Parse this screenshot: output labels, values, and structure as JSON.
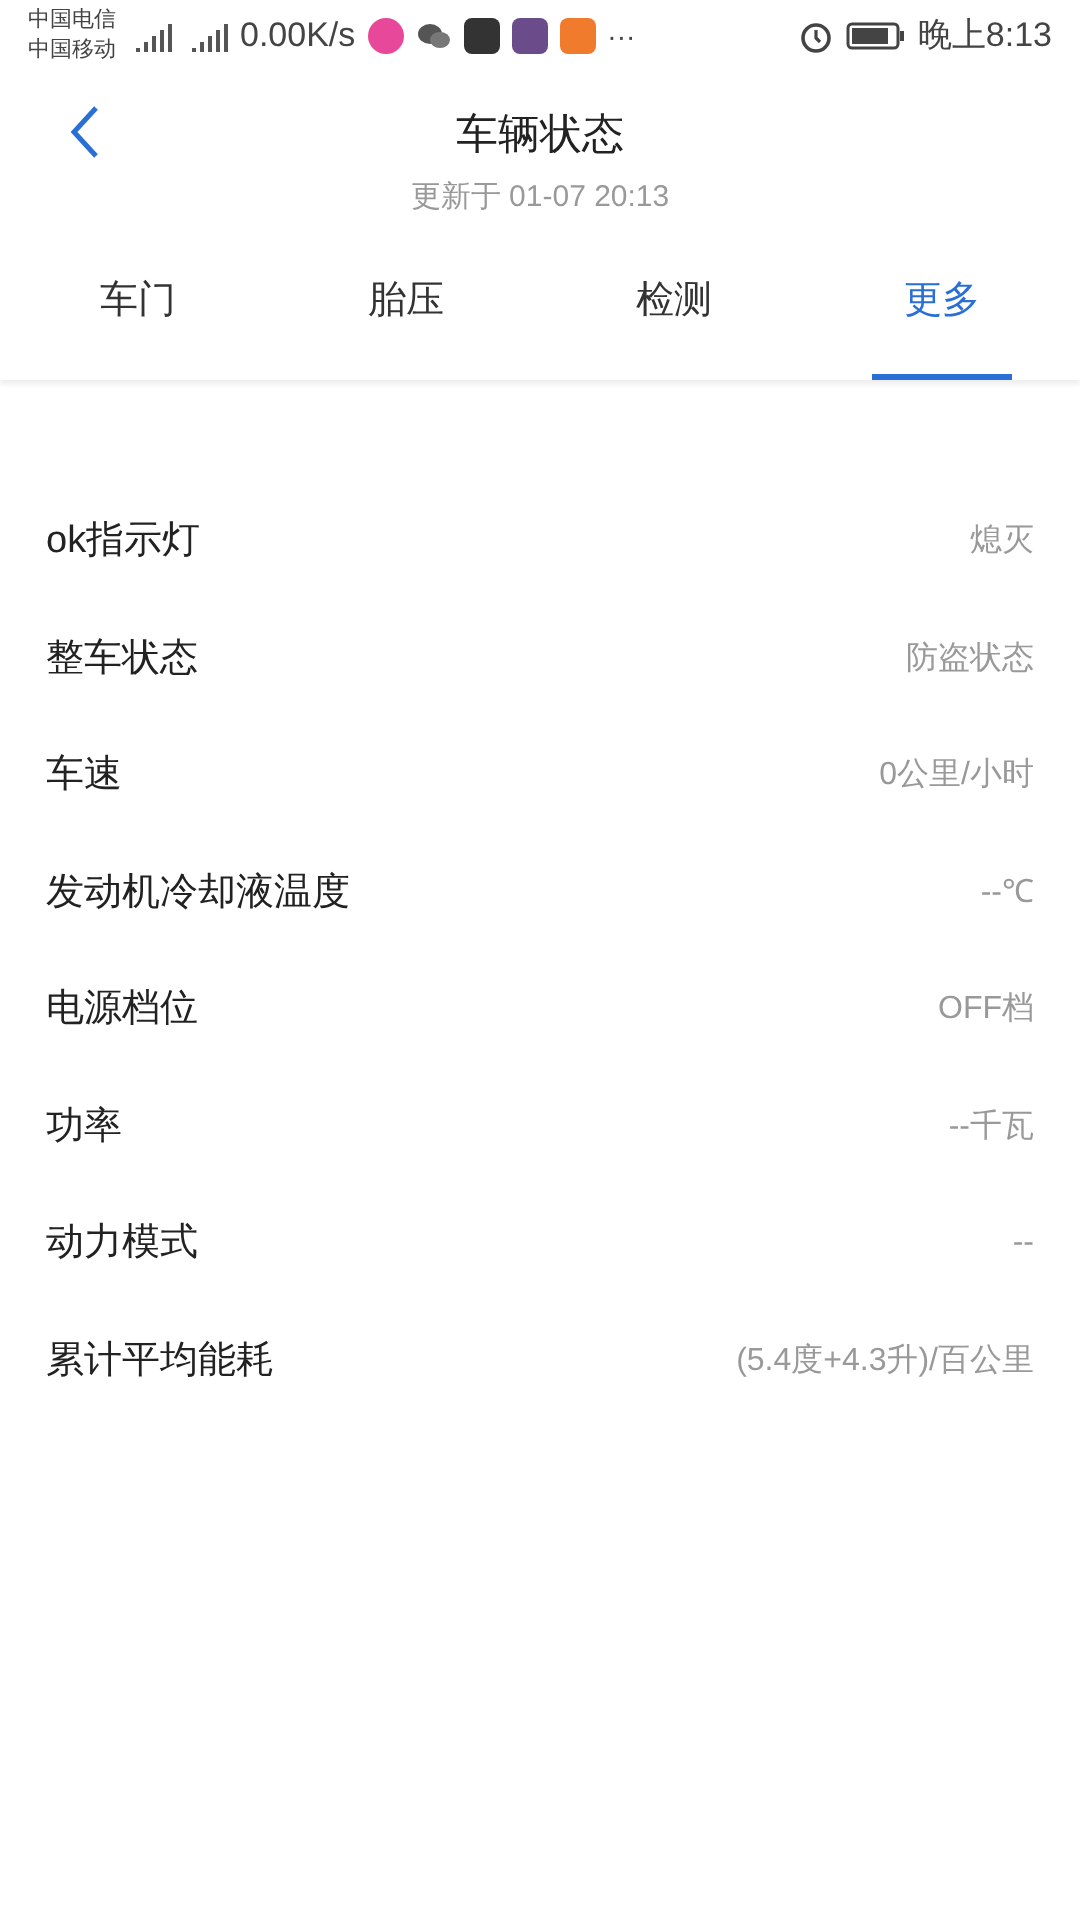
{
  "status_bar": {
    "carriers": [
      "中国电信",
      "中国移动"
    ],
    "speed": "0.00K/s",
    "more": "···",
    "time": "晚上8:13"
  },
  "header": {
    "title": "车辆状态",
    "subtitle": "更新于 01-07 20:13"
  },
  "tabs": [
    {
      "label": "车门",
      "selected": false
    },
    {
      "label": "胎压",
      "selected": false
    },
    {
      "label": "检测",
      "selected": false
    },
    {
      "label": "更多",
      "selected": true
    }
  ],
  "rows": [
    {
      "label": "ok指示灯",
      "value": "熄灭"
    },
    {
      "label": "整车状态",
      "value": "防盗状态"
    },
    {
      "label": "车速",
      "value": "0公里/小时"
    },
    {
      "label": "发动机冷却液温度",
      "value": "--℃"
    },
    {
      "label": "电源档位",
      "value": "OFF档"
    },
    {
      "label": "功率",
      "value": "--千瓦"
    },
    {
      "label": "动力模式",
      "value": "--"
    },
    {
      "label": "累计平均能耗",
      "value": "(5.4度+4.3升)/百公里"
    }
  ]
}
